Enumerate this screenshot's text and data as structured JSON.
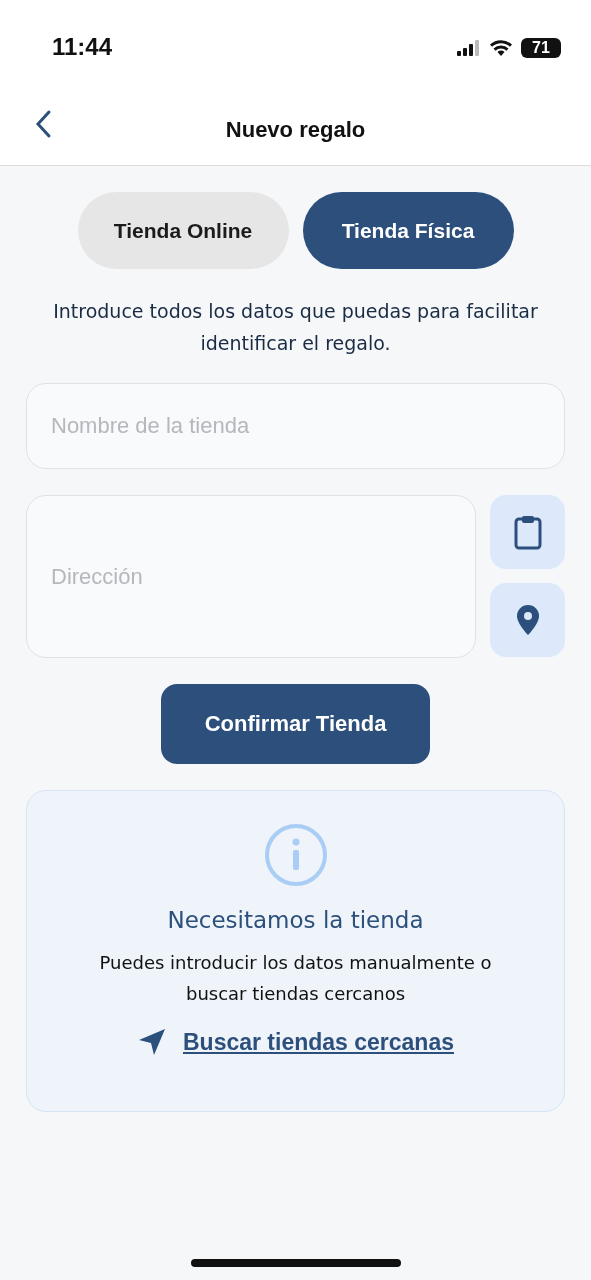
{
  "status_bar": {
    "time": "11:44",
    "battery": "71"
  },
  "header": {
    "title": "Nuevo regalo"
  },
  "tabs": [
    {
      "label": "Tienda Online",
      "selected": false
    },
    {
      "label": "Tienda Física",
      "selected": true
    }
  ],
  "instruction": "Introduce todos los datos que puedas para facilitar identificar el regalo.",
  "store_name": {
    "placeholder": "Nombre de la tienda"
  },
  "address": {
    "placeholder": "Dirección"
  },
  "confirm_button": "Confirmar Tienda",
  "info_card": {
    "title": "Necesitamos la tienda",
    "message": "Puedes introducir los datos manualmente o buscar tiendas cercanos",
    "link": "Buscar tiendas cercanas"
  }
}
